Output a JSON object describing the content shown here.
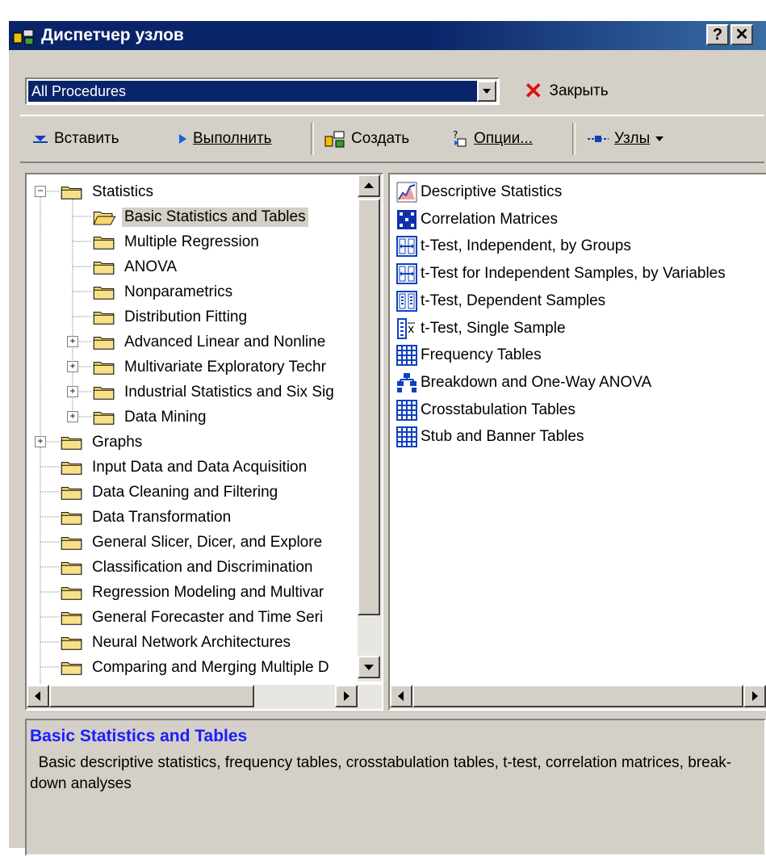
{
  "window": {
    "title": "Диспетчер узлов",
    "help_label": "?",
    "close_label": "✕"
  },
  "procedures": {
    "selected": "All Procedures",
    "close_label": "Закрыть"
  },
  "toolbar": {
    "insert_label": "Вставить",
    "run_label": "Выполнить",
    "create_label": "Создать",
    "options_label": "Опции...",
    "nodes_label": "Узлы"
  },
  "tree": {
    "items": [
      {
        "label": "Statistics",
        "level": 0,
        "expander": "minus"
      },
      {
        "label": "Basic Statistics and Tables",
        "level": 1,
        "expander": "none",
        "selected": true
      },
      {
        "label": "Multiple Regression",
        "level": 1,
        "expander": "none"
      },
      {
        "label": "ANOVA",
        "level": 1,
        "expander": "none"
      },
      {
        "label": "Nonparametrics",
        "level": 1,
        "expander": "none"
      },
      {
        "label": "Distribution Fitting",
        "level": 1,
        "expander": "none"
      },
      {
        "label": "Advanced Linear and Nonline",
        "level": 1,
        "expander": "plus"
      },
      {
        "label": "Multivariate Exploratory Techr",
        "level": 1,
        "expander": "plus"
      },
      {
        "label": "Industrial Statistics and Six Sig",
        "level": 1,
        "expander": "plus"
      },
      {
        "label": "Data Mining",
        "level": 1,
        "expander": "plus"
      },
      {
        "label": "Graphs",
        "level": 0,
        "expander": "plus"
      },
      {
        "label": "Input Data and Data Acquisition",
        "level": 0,
        "expander": "none"
      },
      {
        "label": "Data Cleaning and Filtering",
        "level": 0,
        "expander": "none"
      },
      {
        "label": "Data Transformation",
        "level": 0,
        "expander": "none"
      },
      {
        "label": "General Slicer, Dicer, and Explore",
        "level": 0,
        "expander": "none"
      },
      {
        "label": "Classification and Discrimination",
        "level": 0,
        "expander": "none"
      },
      {
        "label": "Regression Modeling and Multivar",
        "level": 0,
        "expander": "none"
      },
      {
        "label": "General Forecaster and Time Seri",
        "level": 0,
        "expander": "none"
      },
      {
        "label": "Neural Network Architectures",
        "level": 0,
        "expander": "none"
      },
      {
        "label": "Comparing and Merging Multiple D",
        "level": 0,
        "expander": "none"
      }
    ]
  },
  "procedures_list": {
    "items": [
      {
        "label": "Descriptive Statistics",
        "icon": "descriptive-stats-icon"
      },
      {
        "label": "Correlation Matrices",
        "icon": "correlation-matrix-icon"
      },
      {
        "label": "t-Test, Independent, by Groups",
        "icon": "ttest-groups-icon"
      },
      {
        "label": "t-Test for Independent Samples, by Variables",
        "icon": "ttest-variables-icon"
      },
      {
        "label": "t-Test, Dependent Samples",
        "icon": "ttest-dependent-icon"
      },
      {
        "label": "t-Test, Single Sample",
        "icon": "ttest-single-icon"
      },
      {
        "label": "Frequency Tables",
        "icon": "frequency-table-icon"
      },
      {
        "label": "Breakdown and One-Way ANOVA",
        "icon": "breakdown-icon"
      },
      {
        "label": "Crosstabulation Tables",
        "icon": "crosstab-icon"
      },
      {
        "label": "Stub and Banner Tables",
        "icon": "stub-banner-icon"
      }
    ]
  },
  "description": {
    "title": "Basic Statistics and Tables",
    "body": "  Basic descriptive statistics, frequency tables, crosstabulation tables, t-test, correlation matrices, break-down analyses"
  },
  "colors": {
    "titlebar": "#0a246a",
    "selection": "#0a246a",
    "description_title": "#1c1cff",
    "close_x": "#e01010"
  }
}
